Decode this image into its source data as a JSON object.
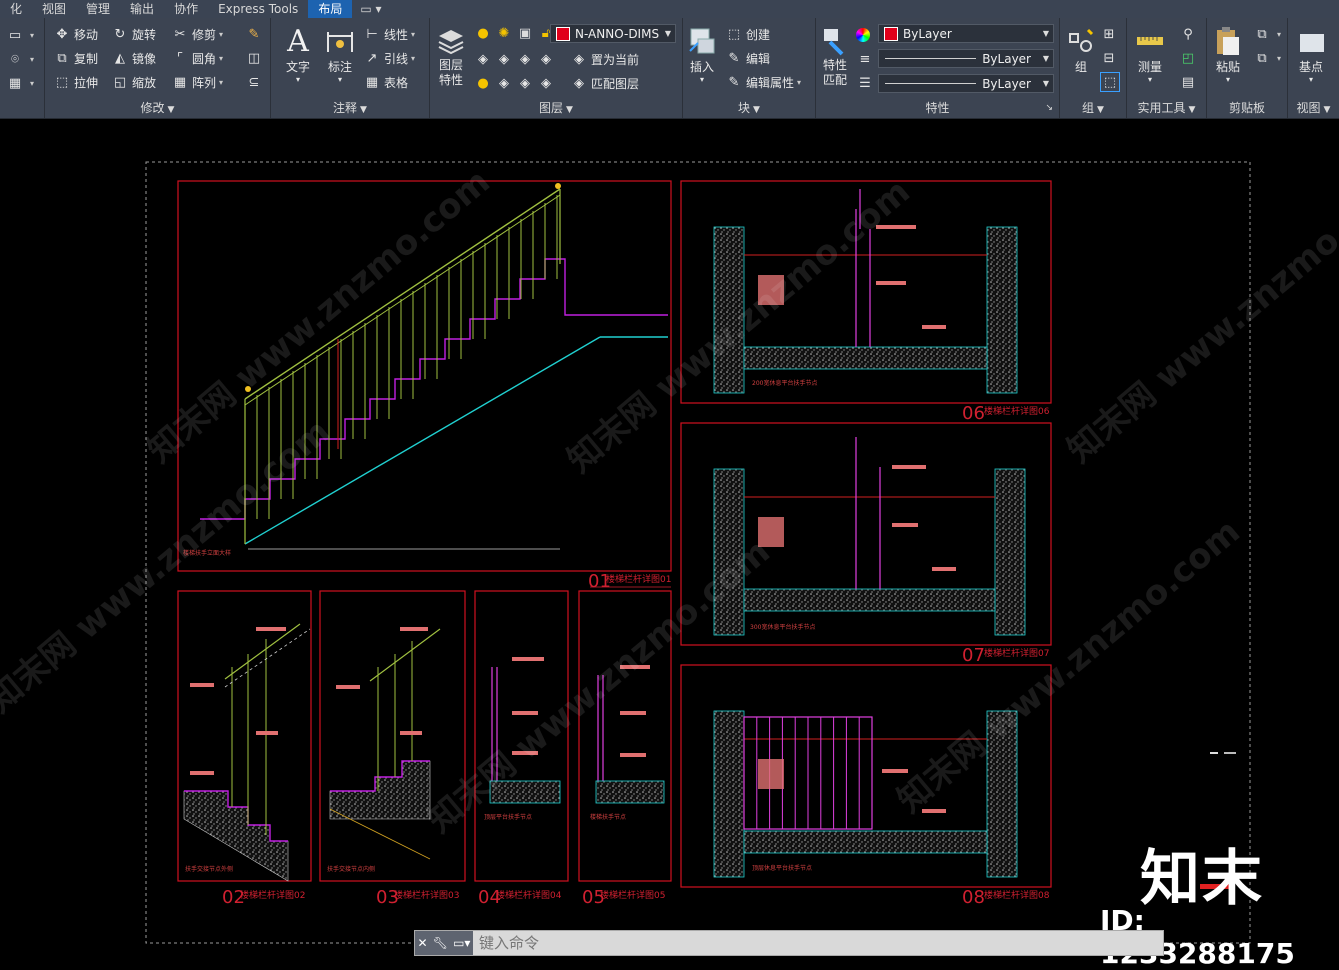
{
  "menubar": {
    "items": [
      "化",
      "视图",
      "管理",
      "输出",
      "协作",
      "Express Tools",
      "布局"
    ],
    "active": "布局",
    "extra_icon": "window-icon"
  },
  "ribbon": {
    "modify": {
      "title": "修改",
      "tools": [
        "移动",
        "旋转",
        "修剪",
        "复制",
        "镜像",
        "圆角",
        "拉伸",
        "缩放",
        "阵列"
      ]
    },
    "annotation": {
      "title": "注释",
      "big": [
        "文字",
        "标注"
      ],
      "tools": [
        "线性",
        "引线",
        "表格"
      ]
    },
    "layers": {
      "title": "图层",
      "big": "图层特性",
      "current_layer": "N-ANNO-DIMS",
      "tools": [
        "置为当前",
        "匹配图层"
      ]
    },
    "block": {
      "title": "块",
      "big": "插入",
      "tools": [
        "创建",
        "编辑",
        "编辑属性"
      ]
    },
    "properties": {
      "title": "特性",
      "big": "特性匹配",
      "color": "ByLayer",
      "linetype": "ByLayer",
      "lineweight": "ByLayer",
      "color_hex": "#e0001b"
    },
    "group": {
      "title": "组",
      "big": "组"
    },
    "utilities": {
      "title": "实用工具",
      "big": "测量"
    },
    "clipboard": {
      "title": "剪贴板",
      "big": "粘贴"
    },
    "view": {
      "title": "视图",
      "big": "基点"
    }
  },
  "drawing": {
    "views": [
      {
        "num": "01",
        "title": "楼梯栏杆详图01",
        "caption": "楼梯扶手立面大样"
      },
      {
        "num": "02",
        "title": "楼梯栏杆详图02",
        "caption": "扶手交接节点外侧"
      },
      {
        "num": "03",
        "title": "楼梯栏杆详图03",
        "caption": "扶手交接节点内侧"
      },
      {
        "num": "04",
        "title": "楼梯栏杆详图04",
        "caption": "顶层平台扶手节点"
      },
      {
        "num": "05",
        "title": "楼梯栏杆详图05",
        "caption": "楼梯扶手节点"
      },
      {
        "num": "06",
        "title": "楼梯栏杆详图06",
        "caption": "200宽休息平台扶手节点"
      },
      {
        "num": "07",
        "title": "楼梯栏杆详图07",
        "caption": "300宽休息平台扶手节点"
      },
      {
        "num": "08",
        "title": "楼梯栏杆详图08",
        "caption": "顶层休息平台扶手节点"
      }
    ],
    "watermark": "知末网 www.znzmo.com"
  },
  "command": {
    "placeholder": "键入命令"
  },
  "brand": {
    "name": "知末",
    "id": "ID: 1233288175"
  }
}
